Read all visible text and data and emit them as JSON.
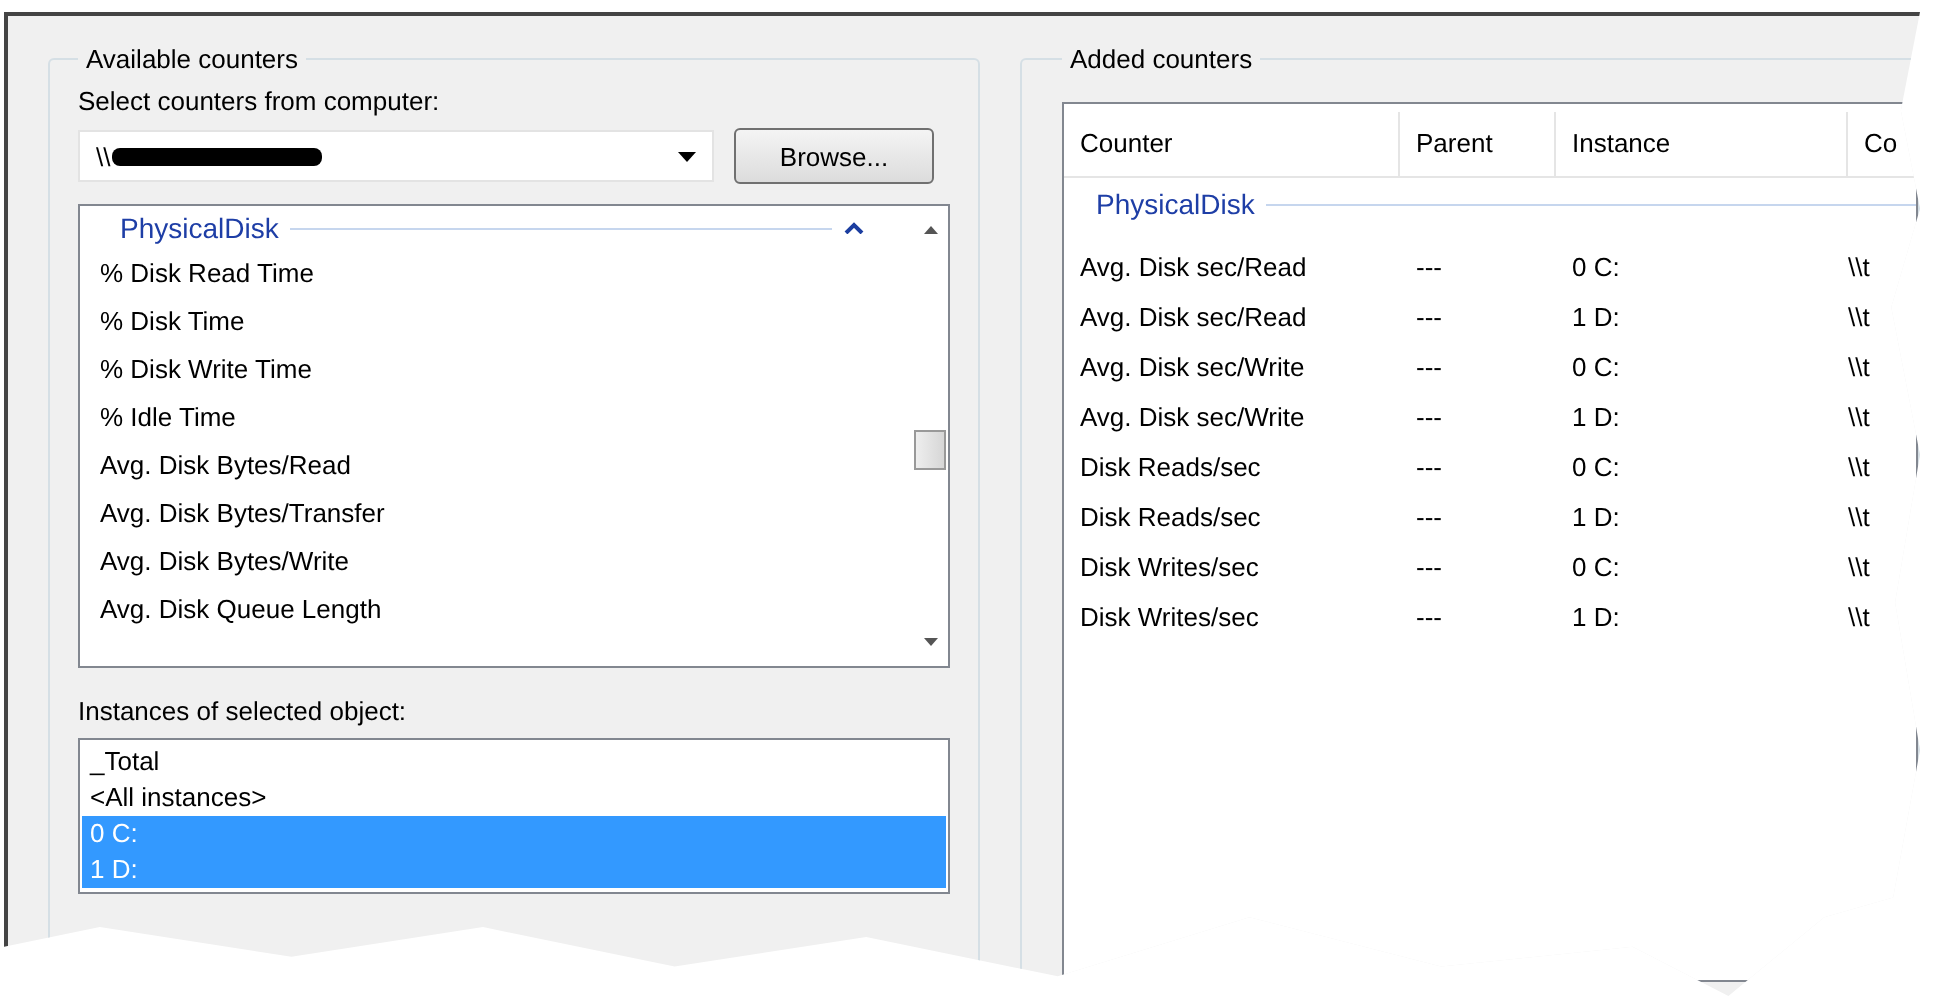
{
  "available": {
    "title": "Available counters",
    "computer_label": "Select counters from computer:",
    "computer_value": "\\\\",
    "browse_button": "Browse...",
    "counter_list": {
      "group": "PhysicalDisk",
      "expanded": true,
      "items": [
        {
          "label": "% Disk Read Time",
          "selected": false
        },
        {
          "label": "% Disk Time",
          "selected": false
        },
        {
          "label": "% Disk Write Time",
          "selected": false
        },
        {
          "label": "% Idle Time",
          "selected": false
        },
        {
          "label": "Avg. Disk Bytes/Read",
          "selected": false
        },
        {
          "label": "Avg. Disk Bytes/Transfer",
          "selected": false
        },
        {
          "label": "Avg. Disk Bytes/Write",
          "selected": false
        },
        {
          "label": "Avg. Disk Queue Length",
          "selected": false
        }
      ]
    },
    "instances_label": "Instances of selected object:",
    "instances": [
      {
        "label": "_Total",
        "selected": false
      },
      {
        "label": "<All instances>",
        "selected": false
      },
      {
        "label": "0 C:",
        "selected": true
      },
      {
        "label": "1 D:",
        "selected": true
      }
    ]
  },
  "added": {
    "title": "Added counters",
    "columns": [
      "Counter",
      "Parent",
      "Instance",
      "Co"
    ],
    "group": "PhysicalDisk",
    "rows": [
      [
        "Avg. Disk sec/Read",
        "---",
        "0 C:",
        "\\\\t"
      ],
      [
        "Avg. Disk sec/Read",
        "---",
        "1 D:",
        "\\\\t"
      ],
      [
        "Avg. Disk sec/Write",
        "---",
        "0 C:",
        "\\\\t"
      ],
      [
        "Avg. Disk sec/Write",
        "---",
        "1 D:",
        "\\\\t"
      ],
      [
        "Disk Reads/sec",
        "---",
        "0 C:",
        "\\\\t"
      ],
      [
        "Disk Reads/sec",
        "---",
        "1 D:",
        "\\\\t"
      ],
      [
        "Disk Writes/sec",
        "---",
        "0 C:",
        "\\\\t"
      ],
      [
        "Disk Writes/sec",
        "---",
        "1 D:",
        "\\\\t"
      ]
    ]
  }
}
